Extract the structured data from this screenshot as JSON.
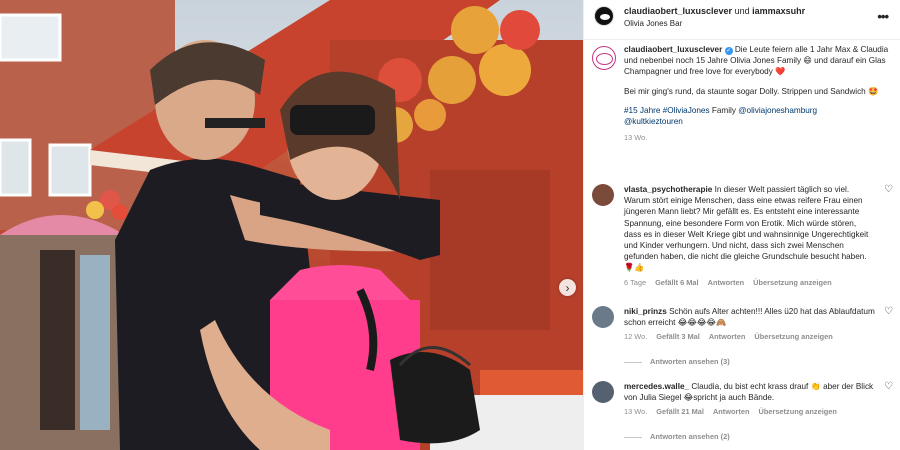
{
  "header": {
    "user1": "claudiaobert_luxusclever",
    "connector": " und ",
    "user2": "iammaxsuhr",
    "location": "Olivia Jones Bar",
    "more_icon": "more-horizontal-icon"
  },
  "caption": {
    "username": "claudiaobert_luxusclever",
    "text1": "Die Leute feiern alle 1 Jahr Max & Claudia und nebenbei noch 15 Jahre Olivia Jones Family 😄 und darauf ein Glas Champagner und free love for everybody ❤️",
    "text2": "Bei mir ging's rund, da staunte sogar Dolly. Strippen und Sandwich 🤩",
    "text3_pre": "#15 Jahre ",
    "tag1": "#OliviaJones",
    "text3_mid": " Family ",
    "mention1": "@oliviajoneshamburg",
    "mention2": "@kultkieztouren",
    "time": "13 Wo."
  },
  "comments": [
    {
      "username": "vlasta_psychotherapie",
      "text": "In dieser Welt passiert täglich so viel. Warum stört einige Menschen, dass eine etwas reifere Frau einen jüngeren Mann liebt? Mir gefällt es. Es entsteht eine interessante Spannung, eine besondere Form von Erotik. Mich würde stören, dass es in dieser Welt Kriege gibt und wahnsinnige Ungerechtigkeit und Kinder verhungern. Und nicht, dass sich zwei Menschen gefunden haben, die nicht die gleiche Grundschule besucht haben.🌹👍",
      "time": "6 Tage",
      "likes": "Gefällt 6 Mal",
      "reply": "Antworten",
      "translate": "Übersetzung anzeigen",
      "avatar_color": "#7a4a3a"
    },
    {
      "username": "niki_prinzs",
      "text": "Schön aufs Alter achten!!! Alles ü20 hat das Ablaufdatum schon erreicht 😂😂😂😂🙈",
      "time": "12 Wo.",
      "likes": "Gefällt 3 Mal",
      "reply": "Antworten",
      "translate": "Übersetzung anzeigen",
      "view_replies": "Antworten ansehen (3)",
      "avatar_color": "#6b7a88"
    },
    {
      "username": "mercedes.walle_",
      "text": "Claudia, du bist echt krass drauf 👏 aber der Blick von Julia Siegel 😂spricht ja auch Bände.",
      "time": "13 Wo.",
      "likes": "Gefällt 21 Mal",
      "reply": "Antworten",
      "translate": "Übersetzung anzeigen",
      "view_replies": "Antworten ansehen (2)",
      "avatar_color": "#556070"
    }
  ],
  "icons": {
    "heart": "heart-outline-icon",
    "next": "chevron-right-icon",
    "verified": "verified-badge-icon"
  }
}
